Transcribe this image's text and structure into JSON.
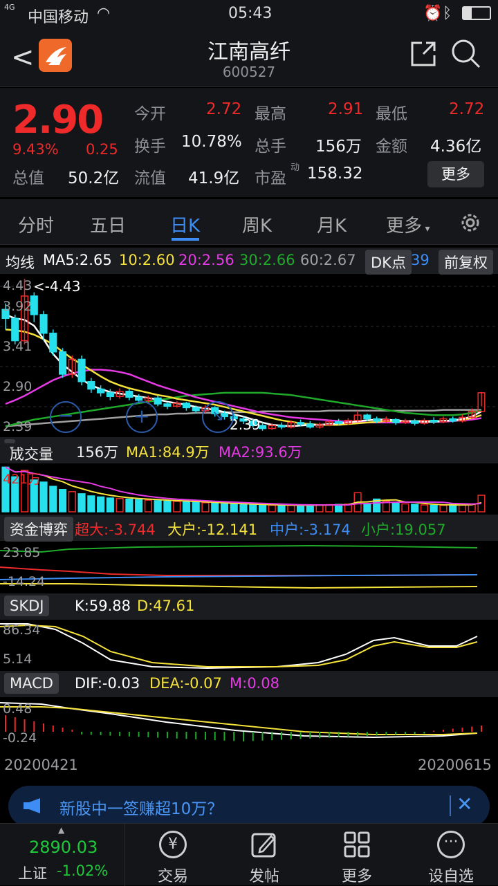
{
  "status": {
    "carrier": "中国移动",
    "time": "05:43",
    "network": "4G"
  },
  "header": {
    "name": "江南高纤",
    "code": "600527"
  },
  "quote": {
    "price": "2.90",
    "pct": "9.43%",
    "chg": "0.25",
    "open_l": "今开",
    "open": "2.72",
    "high_l": "最高",
    "high": "2.91",
    "low_l": "最低",
    "low": "2.72",
    "turn_l": "换手",
    "turn": "10.78%",
    "vol_l": "总手",
    "vol": "156万",
    "amt_l": "金额",
    "amt": "4.36亿",
    "cap_l": "总值",
    "cap": "50.2亿",
    "float_l": "流值",
    "float": "41.9亿",
    "pe_l": "市盈",
    "pe_sup": "动",
    "pe": "158.32",
    "more": "更多"
  },
  "tabs": [
    "分时",
    "五日",
    "日K",
    "周K",
    "月K",
    "更多"
  ],
  "ma": {
    "label": "均线",
    "ma5": "MA5:2.65",
    "ma10": "10:2.60",
    "ma20": "20:2.56",
    "ma30": "30:2.66",
    "ma60": "60:2.67",
    "dk": "DK点",
    "dk_num": "39",
    "fq": "前复权"
  },
  "kline": {
    "ticks": [
      "4.43",
      "3.92",
      "3.41",
      "2.90",
      "2.39"
    ],
    "high_mark": "<-4.43",
    "low_mark": "2.39"
  },
  "volume": {
    "label": "成交量",
    "val": "156万",
    "ma1": "MA1:84.9万",
    "ma2": "MA2:93.6万",
    "tick": "421万"
  },
  "fund": {
    "label": "资金博弈",
    "big": "超大:-3.744",
    "large": "大户:-12.141",
    "mid": "中户:-3.174",
    "small": "小户:19.057",
    "ticks": [
      "23.85",
      "-14.24"
    ]
  },
  "skdj": {
    "label": "SKDJ",
    "k": "K:59.88",
    "d": "D:47.61",
    "ticks": [
      "86.34",
      "5.14"
    ]
  },
  "macd": {
    "label": "MACD",
    "dif": "DIF:-0.03",
    "dea": "DEA:-0.07",
    "m": "M:0.08",
    "ticks": [
      "0.48",
      "-0.24"
    ]
  },
  "dates": {
    "start": "20200421",
    "end": "20200615"
  },
  "banner": {
    "text": "新股中一签赚超10万？"
  },
  "bottom": {
    "index_val": "2890.03",
    "index_name": "上证",
    "index_pct": "-1.02%",
    "trade": "交易",
    "post": "发帖",
    "more": "更多",
    "fav": "设自选"
  },
  "colors": {
    "up": "#ee2a2a",
    "down": "#27e0ee",
    "ma5": "#ffffff",
    "ma10": "#f5e23a",
    "ma20": "#e53ae5",
    "ma30": "#1faa2a",
    "ma60": "#a0a0a0",
    "accent": "#3d8df5"
  },
  "chart_data": {
    "type": "candlestick",
    "candles": [
      [
        4.02,
        3.9,
        4.1,
        3.75
      ],
      [
        3.9,
        3.6,
        3.95,
        3.55
      ],
      [
        3.6,
        4.2,
        4.43,
        3.55
      ],
      [
        4.2,
        3.95,
        4.25,
        3.85
      ],
      [
        3.95,
        3.7,
        4.0,
        3.6
      ],
      [
        3.7,
        3.45,
        3.75,
        3.4
      ],
      [
        3.45,
        3.15,
        3.5,
        3.1
      ],
      [
        3.15,
        3.35,
        3.4,
        3.1
      ],
      [
        3.35,
        3.05,
        3.4,
        3.0
      ],
      [
        3.05,
        2.95,
        3.1,
        2.9
      ],
      [
        2.95,
        2.9,
        3.0,
        2.85
      ],
      [
        2.9,
        2.85,
        2.95,
        2.8
      ],
      [
        2.85,
        2.92,
        2.96,
        2.82
      ],
      [
        2.92,
        2.84,
        2.95,
        2.8
      ],
      [
        2.84,
        2.8,
        2.88,
        2.76
      ],
      [
        2.8,
        2.83,
        2.86,
        2.77
      ],
      [
        2.83,
        2.75,
        2.86,
        2.72
      ],
      [
        2.75,
        2.72,
        2.78,
        2.68
      ],
      [
        2.72,
        2.76,
        2.79,
        2.7
      ],
      [
        2.76,
        2.7,
        2.78,
        2.66
      ],
      [
        2.7,
        2.66,
        2.73,
        2.62
      ],
      [
        2.66,
        2.7,
        2.73,
        2.63
      ],
      [
        2.7,
        2.62,
        2.72,
        2.58
      ],
      [
        2.62,
        2.58,
        2.66,
        2.54
      ],
      [
        2.58,
        2.55,
        2.62,
        2.52
      ],
      [
        2.55,
        2.52,
        2.58,
        2.48
      ],
      [
        2.52,
        2.46,
        2.55,
        2.43
      ],
      [
        2.46,
        2.42,
        2.5,
        2.39
      ],
      [
        2.42,
        2.46,
        2.49,
        2.4
      ],
      [
        2.46,
        2.44,
        2.5,
        2.41
      ],
      [
        2.44,
        2.5,
        2.53,
        2.42
      ],
      [
        2.5,
        2.48,
        2.54,
        2.45
      ],
      [
        2.48,
        2.44,
        2.52,
        2.42
      ],
      [
        2.44,
        2.47,
        2.5,
        2.42
      ],
      [
        2.47,
        2.51,
        2.54,
        2.45
      ],
      [
        2.51,
        2.49,
        2.55,
        2.46
      ],
      [
        2.49,
        2.53,
        2.56,
        2.47
      ],
      [
        2.53,
        2.6,
        2.66,
        2.51
      ],
      [
        2.6,
        2.55,
        2.62,
        2.52
      ],
      [
        2.55,
        2.52,
        2.58,
        2.49
      ],
      [
        2.52,
        2.54,
        2.58,
        2.5
      ],
      [
        2.54,
        2.5,
        2.56,
        2.47
      ],
      [
        2.5,
        2.52,
        2.55,
        2.48
      ],
      [
        2.52,
        2.49,
        2.55,
        2.46
      ],
      [
        2.49,
        2.53,
        2.56,
        2.47
      ],
      [
        2.53,
        2.51,
        2.57,
        2.48
      ],
      [
        2.51,
        2.55,
        2.58,
        2.49
      ],
      [
        2.55,
        2.52,
        2.58,
        2.5
      ],
      [
        2.52,
        2.57,
        2.61,
        2.5
      ],
      [
        2.57,
        2.65,
        2.69,
        2.55
      ],
      [
        2.65,
        2.9,
        2.91,
        2.72
      ]
    ],
    "ma5": [
      3.95,
      3.9,
      3.88,
      3.8,
      3.62,
      3.42,
      3.28,
      3.18,
      3.08,
      3.0,
      2.95,
      2.91,
      2.89,
      2.87,
      2.85,
      2.83,
      2.81,
      2.78,
      2.76,
      2.74,
      2.71,
      2.69,
      2.67,
      2.64,
      2.61,
      2.58,
      2.54,
      2.5,
      2.47,
      2.46,
      2.45,
      2.46,
      2.47,
      2.47,
      2.48,
      2.49,
      2.5,
      2.52,
      2.53,
      2.54,
      2.54,
      2.53,
      2.52,
      2.52,
      2.51,
      2.51,
      2.52,
      2.53,
      2.55,
      2.58,
      2.65
    ],
    "ma10": [
      3.75,
      3.74,
      3.72,
      3.68,
      3.62,
      3.55,
      3.45,
      3.36,
      3.28,
      3.2,
      3.12,
      3.05,
      3.0,
      2.96,
      2.93,
      2.9,
      2.87,
      2.85,
      2.82,
      2.8,
      2.78,
      2.76,
      2.74,
      2.71,
      2.68,
      2.65,
      2.62,
      2.59,
      2.56,
      2.53,
      2.51,
      2.49,
      2.48,
      2.47,
      2.47,
      2.47,
      2.48,
      2.49,
      2.5,
      2.51,
      2.52,
      2.52,
      2.52,
      2.52,
      2.52,
      2.52,
      2.52,
      2.53,
      2.54,
      2.56,
      2.6
    ],
    "ma20": [
      2.75,
      2.8,
      2.86,
      2.93,
      3.0,
      3.07,
      3.12,
      3.16,
      3.19,
      3.21,
      3.21,
      3.2,
      3.18,
      3.15,
      3.1,
      3.05,
      3.0,
      2.96,
      2.92,
      2.88,
      2.84,
      2.81,
      2.78,
      2.75,
      2.72,
      2.69,
      2.66,
      2.63,
      2.61,
      2.59,
      2.57,
      2.56,
      2.55,
      2.54,
      2.53,
      2.52,
      2.51,
      2.51,
      2.5,
      2.5,
      2.5,
      2.5,
      2.5,
      2.5,
      2.51,
      2.51,
      2.51,
      2.52,
      2.53,
      2.54,
      2.56
    ],
    "ma30": [
      2.45,
      2.48,
      2.51,
      2.54,
      2.56,
      2.58,
      2.6,
      2.62,
      2.64,
      2.66,
      2.68,
      2.7,
      2.72,
      2.74,
      2.76,
      2.78,
      2.8,
      2.82,
      2.84,
      2.86,
      2.87,
      2.88,
      2.89,
      2.9,
      2.9,
      2.9,
      2.9,
      2.9,
      2.89,
      2.88,
      2.87,
      2.85,
      2.83,
      2.81,
      2.79,
      2.77,
      2.75,
      2.73,
      2.71,
      2.69,
      2.67,
      2.65,
      2.63,
      2.62,
      2.61,
      2.6,
      2.6,
      2.6,
      2.61,
      2.63,
      2.66
    ],
    "ma60": [
      2.45,
      2.46,
      2.47,
      2.48,
      2.49,
      2.5,
      2.51,
      2.52,
      2.53,
      2.54,
      2.55,
      2.56,
      2.57,
      2.58,
      2.59,
      2.6,
      2.61,
      2.61,
      2.62,
      2.62,
      2.63,
      2.63,
      2.63,
      2.64,
      2.64,
      2.64,
      2.64,
      2.65,
      2.65,
      2.65,
      2.65,
      2.65,
      2.65,
      2.65,
      2.66,
      2.66,
      2.66,
      2.66,
      2.66,
      2.66,
      2.66,
      2.66,
      2.66,
      2.66,
      2.66,
      2.66,
      2.67,
      2.67,
      2.67,
      2.67,
      2.67
    ],
    "volume": [
      421,
      330,
      390,
      300,
      280,
      240,
      210,
      190,
      170,
      150,
      140,
      130,
      125,
      120,
      115,
      110,
      105,
      100,
      98,
      95,
      90,
      85,
      80,
      75,
      72,
      70,
      68,
      65,
      62,
      60,
      60,
      62,
      64,
      66,
      68,
      70,
      72,
      180,
      80,
      120,
      100,
      85,
      75,
      70,
      65,
      62,
      60,
      70,
      65,
      75,
      156
    ]
  }
}
